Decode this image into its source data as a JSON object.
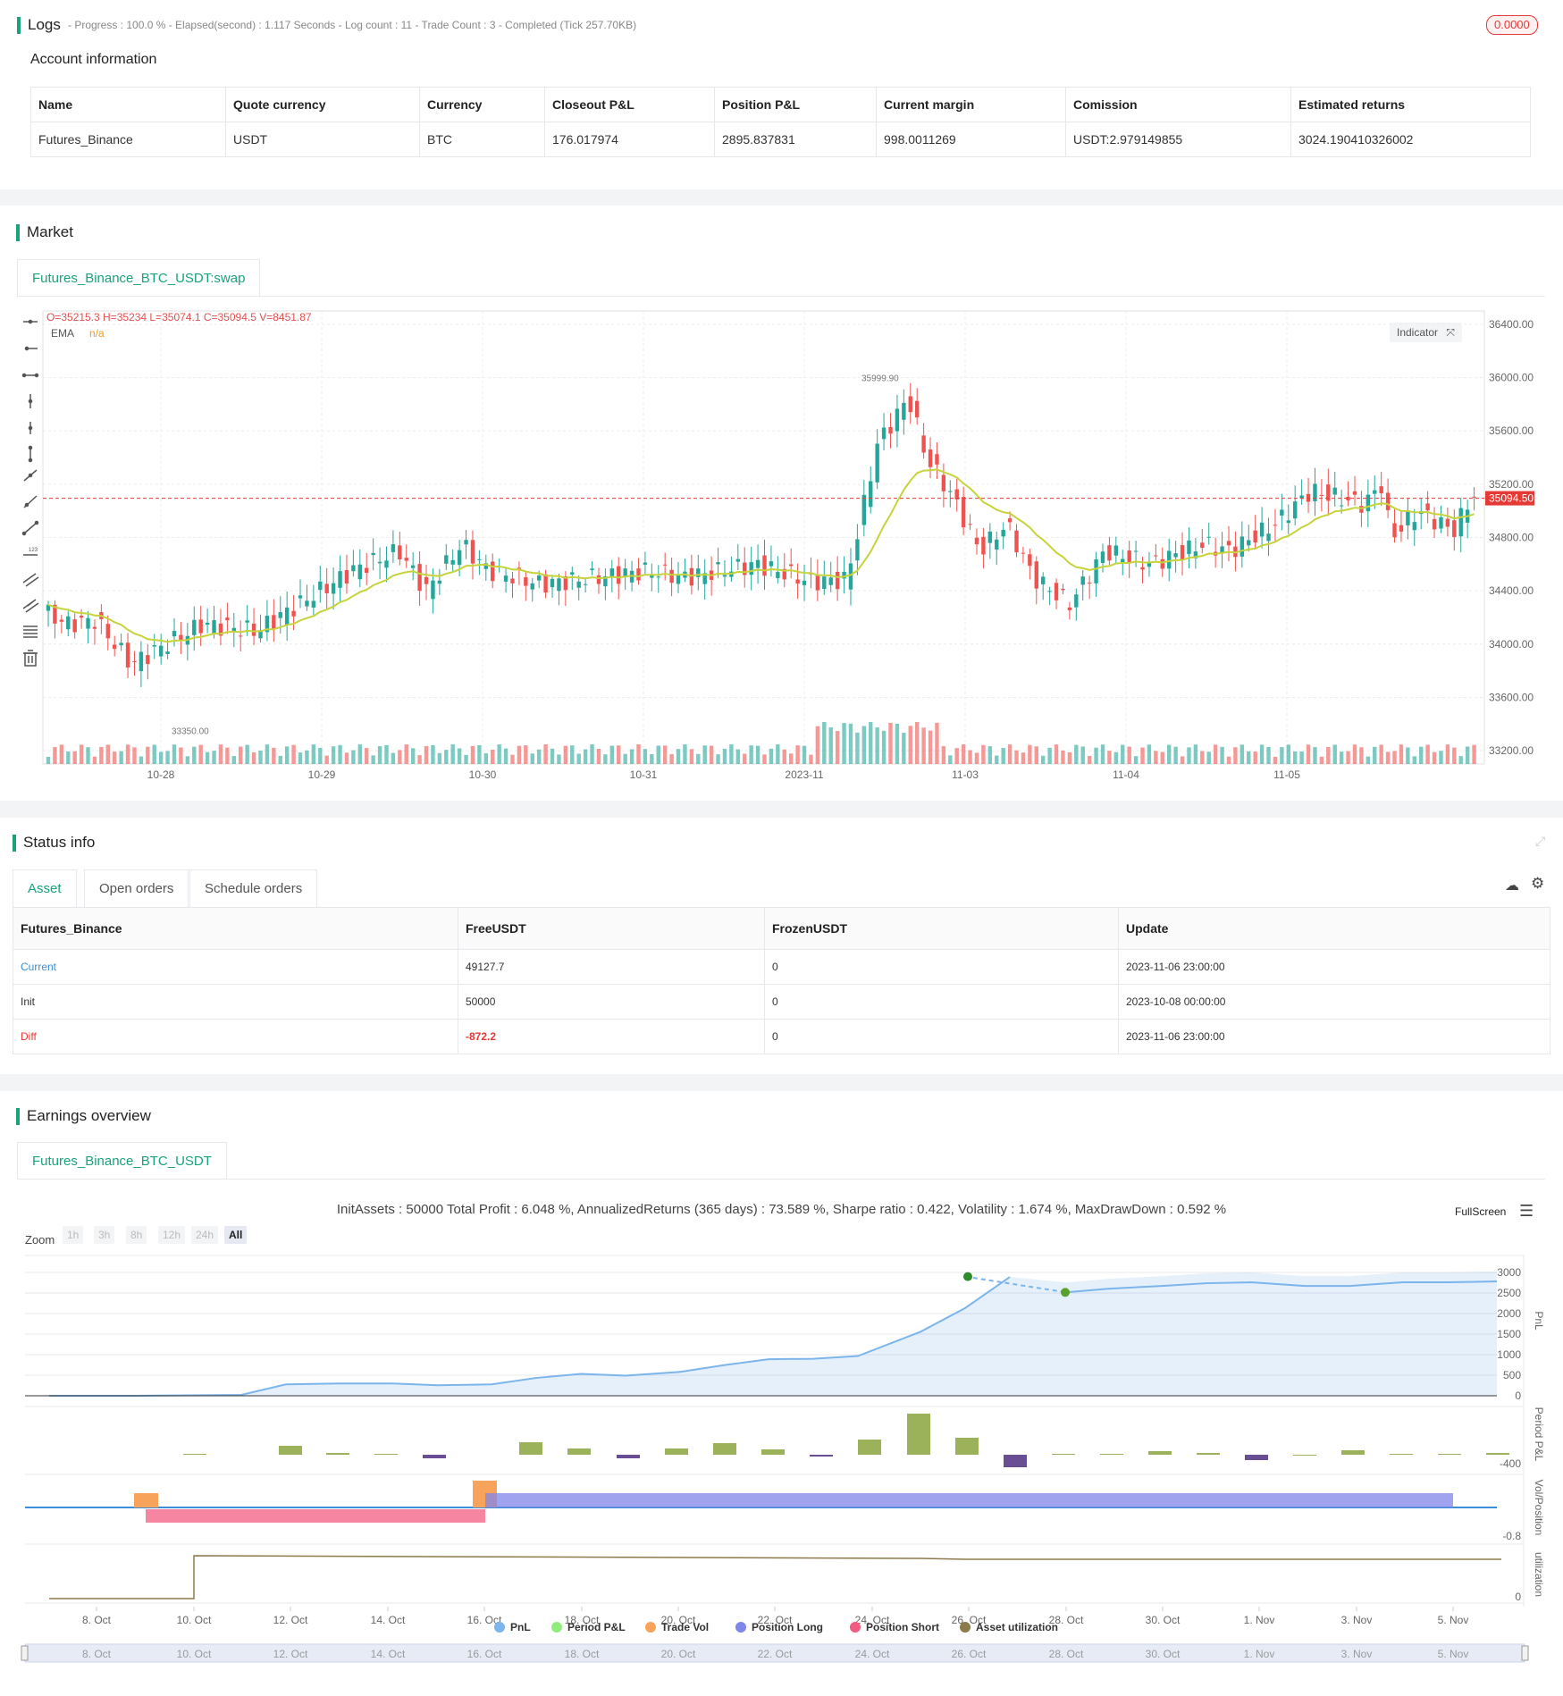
{
  "logs": {
    "title": "Logs",
    "summary": "- Progress : 100.0 % - Elapsed(second) : 1.117  Seconds - Log count : 11 - Trade Count : 3 - Completed (Tick 257.70KB)",
    "badge": "0.0000"
  },
  "account": {
    "title": "Account information",
    "headers": [
      "Name",
      "Quote currency",
      "Currency",
      "Closeout P&L",
      "Position P&L",
      "Current margin",
      "Comission",
      "Estimated returns"
    ],
    "row": [
      "Futures_Binance",
      "USDT",
      "BTC",
      "176.017974",
      "2895.837831",
      "998.0011269",
      "USDT:2.979149855",
      "3024.190410326002"
    ]
  },
  "market": {
    "title": "Market",
    "tab": "Futures_Binance_BTC_USDT:swap",
    "ohlc": "O=35215.3 H=35234 L=35074.1 C=35094.5 V=8451.87",
    "ema_label": "EMA",
    "ema_value": "n/a",
    "indicator_btn": "Indicator",
    "last_price": "35094.50",
    "high_mark": "35999.90",
    "low_mark": "33350.00",
    "y_ticks": [
      "36400.00",
      "36000.00",
      "35600.00",
      "35200.00",
      "34800.00",
      "34400.00",
      "34000.00",
      "33600.00",
      "33200.00"
    ],
    "x_ticks": [
      "10-28",
      "10-29",
      "10-30",
      "10-31",
      "2023-11",
      "11-03",
      "11-04",
      "11-05"
    ],
    "colors": {
      "up": "#26a69a",
      "down": "#ef5350",
      "ema": "#c6d33b"
    }
  },
  "status": {
    "title": "Status info",
    "tabs": [
      "Asset",
      "Open orders",
      "Schedule orders"
    ],
    "headers": [
      "Futures_Binance",
      "FreeUSDT",
      "FrozenUSDT",
      "Update"
    ],
    "rows": [
      [
        "Current",
        "49127.7",
        "0",
        "2023-11-06 23:00:00"
      ],
      [
        "Init",
        "50000",
        "0",
        "2023-10-08 00:00:00"
      ],
      [
        "Diff",
        "-872.2",
        "0",
        "2023-11-06 23:00:00"
      ]
    ]
  },
  "earnings": {
    "title": "Earnings overview",
    "tab": "Futures_Binance_BTC_USDT",
    "summary": "InitAssets : 50000 Total Profit : 6.048 %, AnnualizedReturns (365 days) : 73.589 %, Sharpe ratio : 0.422, Volatility : 1.674 %, MaxDrawDown : 0.592 %",
    "fullscreen": "FullScreen",
    "zoom_label": "Zoom",
    "zoom_options": [
      "1h",
      "3h",
      "8h",
      "12h",
      "24h",
      "All"
    ],
    "pnl_ticks": [
      "3000",
      "2500",
      "2000",
      "1500",
      "1000",
      "500",
      "0"
    ],
    "period_tick": "-400",
    "vol_tick": "-0.8",
    "util_tick": "0",
    "axis_titles": [
      "PnL",
      "Period P&L",
      "Vol/Position",
      "utilization"
    ],
    "x_ticks": [
      "8. Oct",
      "10. Oct",
      "12. Oct",
      "14. Oct",
      "16. Oct",
      "18. Oct",
      "20. Oct",
      "22. Oct",
      "24. Oct",
      "26. Oct",
      "28. Oct",
      "30. Oct",
      "1. Nov",
      "3. Nov",
      "5. Nov"
    ],
    "legend": [
      {
        "label": "PnL",
        "color": "#7cb5ec"
      },
      {
        "label": "Period P&L",
        "color": "#90ed7d"
      },
      {
        "label": "Trade Vol",
        "color": "#f7a35c"
      },
      {
        "label": "Position Long",
        "color": "#8085e9"
      },
      {
        "label": "Position Short",
        "color": "#f15c80"
      },
      {
        "label": "Asset utilization",
        "color": "#8d7a4a"
      }
    ]
  }
}
